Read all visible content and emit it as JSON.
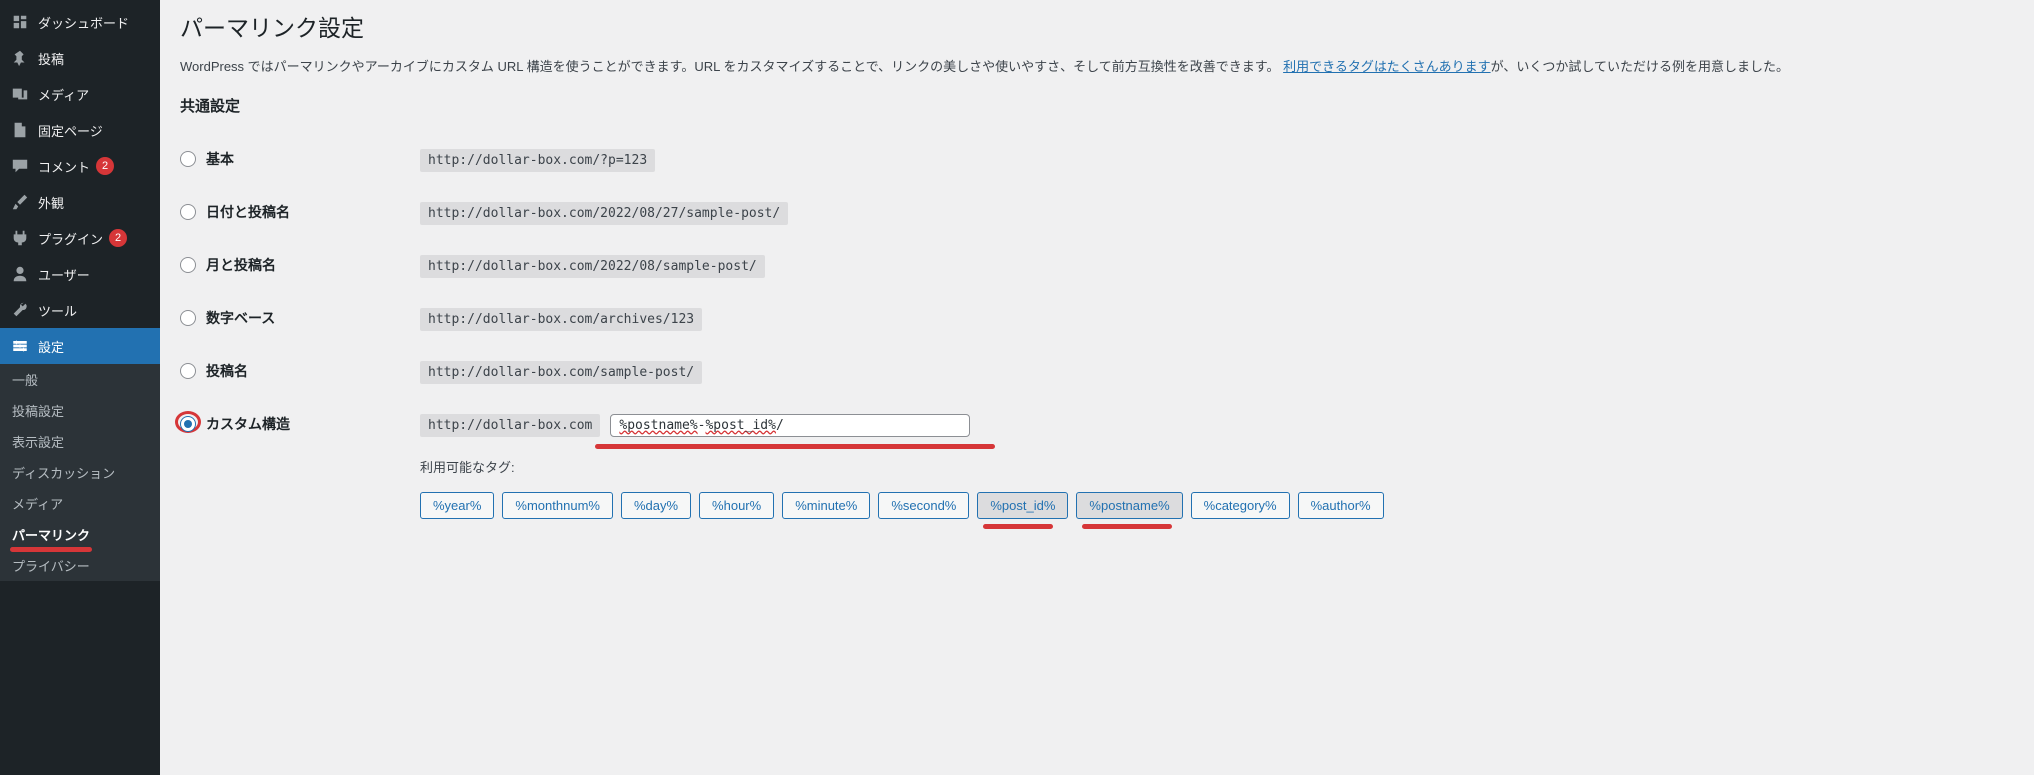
{
  "sidebar": {
    "items": [
      {
        "label": "ダッシュボード",
        "icon": "dashboard"
      },
      {
        "label": "投稿",
        "icon": "pin"
      },
      {
        "label": "メディア",
        "icon": "media"
      },
      {
        "label": "固定ページ",
        "icon": "page"
      },
      {
        "label": "コメント",
        "icon": "comment",
        "badge": "2"
      },
      {
        "label": "外観",
        "icon": "brush"
      },
      {
        "label": "プラグイン",
        "icon": "plugin",
        "badge": "2"
      },
      {
        "label": "ユーザー",
        "icon": "user"
      },
      {
        "label": "ツール",
        "icon": "tool"
      },
      {
        "label": "設定",
        "icon": "settings"
      }
    ],
    "sub": [
      {
        "label": "一般"
      },
      {
        "label": "投稿設定"
      },
      {
        "label": "表示設定"
      },
      {
        "label": "ディスカッション"
      },
      {
        "label": "メディア"
      },
      {
        "label": "パーマリンク"
      },
      {
        "label": "プライバシー"
      }
    ]
  },
  "page": {
    "title": "パーマリンク設定",
    "desc_pre": "WordPress ではパーマリンクやアーカイブにカスタム URL 構造を使うことができます。URL をカスタマイズすることで、リンクの美しさや使いやすさ、そして前方互換性を改善できます。",
    "desc_link": "利用できるタグはたくさんあります",
    "desc_post": "が、いくつか試していただける例を用意しました。",
    "section": "共通設定"
  },
  "options": [
    {
      "label": "基本",
      "code": "http://dollar-box.com/?p=123"
    },
    {
      "label": "日付と投稿名",
      "code": "http://dollar-box.com/2022/08/27/sample-post/"
    },
    {
      "label": "月と投稿名",
      "code": "http://dollar-box.com/2022/08/sample-post/"
    },
    {
      "label": "数字ベース",
      "code": "http://dollar-box.com/archives/123"
    },
    {
      "label": "投稿名",
      "code": "http://dollar-box.com/sample-post/"
    }
  ],
  "custom": {
    "label": "カスタム構造",
    "prefix": "http://dollar-box.com",
    "value_a": "%postname%",
    "value_sep": "-",
    "value_b": "%post_id%",
    "value_suf": "/",
    "tags_label": "利用可能なタグ:"
  },
  "tags": [
    {
      "label": "%year%"
    },
    {
      "label": "%monthnum%"
    },
    {
      "label": "%day%"
    },
    {
      "label": "%hour%"
    },
    {
      "label": "%minute%"
    },
    {
      "label": "%second%"
    },
    {
      "label": "%post_id%",
      "active": true
    },
    {
      "label": "%postname%",
      "active": true
    },
    {
      "label": "%category%"
    },
    {
      "label": "%author%"
    }
  ]
}
